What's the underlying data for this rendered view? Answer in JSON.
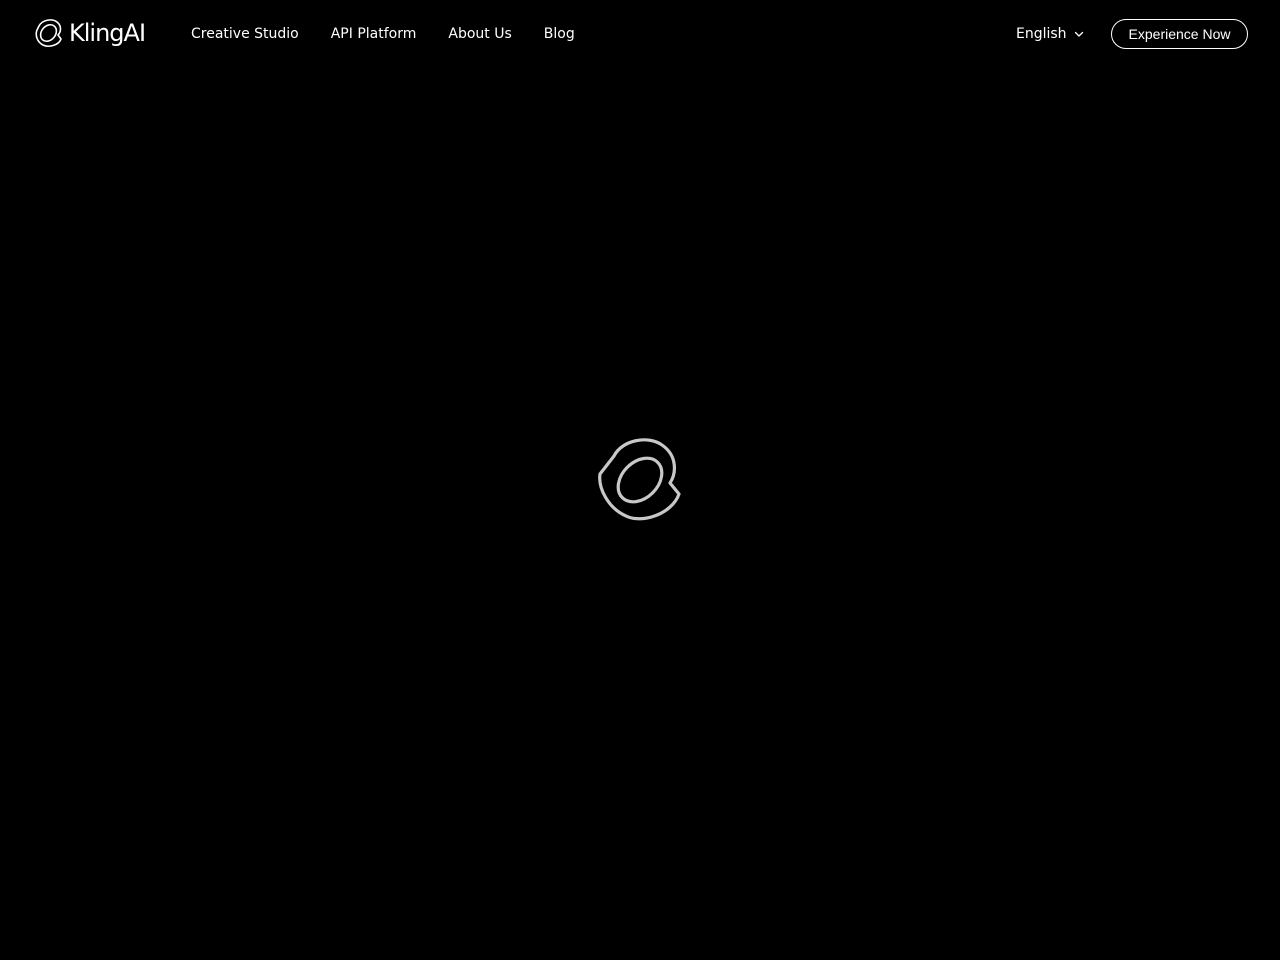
{
  "header": {
    "logo_text": "KlingAI",
    "logo_icon": "kling-logo-icon",
    "nav": [
      {
        "label": "Creative Studio"
      },
      {
        "label": "API Platform"
      },
      {
        "label": "About Us"
      },
      {
        "label": "Blog"
      }
    ],
    "language": {
      "label": "English",
      "icon": "chevron-down-icon"
    },
    "cta_label": "Experience Now"
  },
  "main": {
    "loader_icon": "kling-logo-loading-icon"
  },
  "colors": {
    "background": "#000000",
    "text": "#ffffff",
    "loader": "#c8c8c8"
  }
}
